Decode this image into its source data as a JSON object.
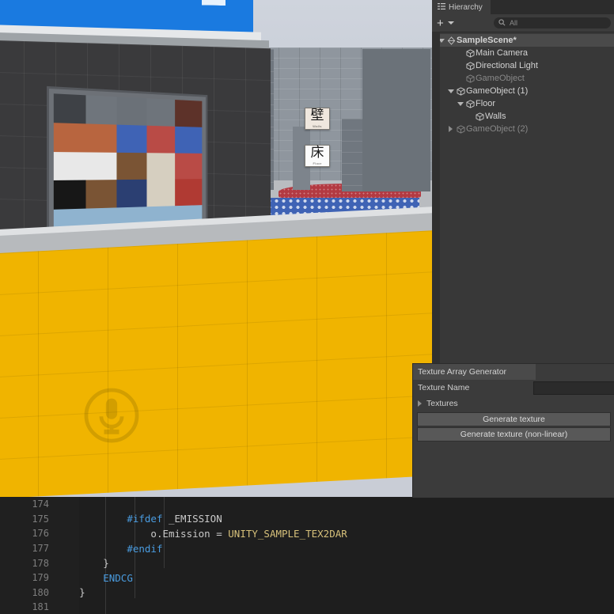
{
  "app": {
    "name": "Unity Editor",
    "colors": {
      "panel_bg": "#383838",
      "toolbar_bg": "#3c3c3c",
      "selection": "#4a4a4a",
      "code_bg": "#1e1e1e",
      "accent_yellow": "#f0b400",
      "keyword_blue": "#4a9ce0",
      "identifier_tan": "#d6c07a"
    }
  },
  "hierarchy": {
    "tab_label": "Hierarchy",
    "tab_icon": "hierarchy-icon",
    "add_button_label": "+",
    "search": {
      "placeholder": "All",
      "value": "",
      "icon": "search-icon"
    },
    "items": [
      {
        "label": "SampleScene*",
        "depth": 0,
        "icon": "unity-scene-icon",
        "twisty": "down",
        "dim": false,
        "selected": true
      },
      {
        "label": "Main Camera",
        "depth": 2,
        "icon": "gameobject-cube-icon",
        "twisty": "none",
        "dim": false,
        "selected": false
      },
      {
        "label": "Directional Light",
        "depth": 2,
        "icon": "gameobject-cube-icon",
        "twisty": "none",
        "dim": false,
        "selected": false
      },
      {
        "label": "GameObject",
        "depth": 2,
        "icon": "gameobject-cube-icon",
        "twisty": "none",
        "dim": true,
        "selected": false
      },
      {
        "label": "GameObject (1)",
        "depth": 1,
        "icon": "gameobject-cube-icon",
        "twisty": "down",
        "dim": false,
        "selected": false
      },
      {
        "label": "Floor",
        "depth": 2,
        "icon": "gameobject-cube-icon",
        "twisty": "down",
        "dim": false,
        "selected": false
      },
      {
        "label": "Walls",
        "depth": 3,
        "icon": "gameobject-cube-icon",
        "twisty": "none",
        "dim": false,
        "selected": false
      },
      {
        "label": "GameObject (2)",
        "depth": 1,
        "icon": "gameobject-cube-icon",
        "twisty": "right",
        "dim": true,
        "selected": false
      }
    ]
  },
  "texture_array_generator": {
    "title": "Texture Array Generator",
    "texture_name_label": "Texture Name",
    "texture_name_value": "",
    "textures_foldout_label": "Textures",
    "textures_foldout_expanded": false,
    "generate_button_label": "Generate texture",
    "generate_nonlinear_button_label": "Generate texture (non-linear)"
  },
  "code_editor": {
    "language": "ShaderLab / CG",
    "first_line_number": 174,
    "lines": [
      {
        "n": "174",
        "tokens": []
      },
      {
        "n": "175",
        "tokens": [
          {
            "t": "            ",
            "c": "ind"
          },
          {
            "t": "#ifdef",
            "c": "kw"
          },
          {
            "t": " _EMISSION",
            "c": "id"
          }
        ]
      },
      {
        "n": "176",
        "tokens": [
          {
            "t": "                ",
            "c": "ind"
          },
          {
            "t": "o.Emission = ",
            "c": "id"
          },
          {
            "t": "UNITY_SAMPLE_TEX2DAR",
            "c": "fn"
          }
        ]
      },
      {
        "n": "177",
        "tokens": [
          {
            "t": "            ",
            "c": "ind"
          },
          {
            "t": "#endif",
            "c": "kw"
          }
        ]
      },
      {
        "n": "178",
        "tokens": [
          {
            "t": "        ",
            "c": "ind"
          },
          {
            "t": "}",
            "c": "op"
          }
        ]
      },
      {
        "n": "179",
        "tokens": [
          {
            "t": "        ",
            "c": "ind"
          },
          {
            "t": "ENDCG",
            "c": "kw"
          }
        ]
      },
      {
        "n": "180",
        "tokens": [
          {
            "t": "    ",
            "c": "ind"
          },
          {
            "t": "}",
            "c": "op"
          }
        ]
      },
      {
        "n": "181",
        "tokens": []
      }
    ]
  },
  "game_view": {
    "signs": [
      {
        "kanji": "壁",
        "roman": "Walls"
      },
      {
        "kanji": "床",
        "roman": "Floor"
      }
    ],
    "watermark_icon": "microphone-icon",
    "texture_atlas_swatches": [
      "#3e4146",
      "#6f757c",
      "#6b7178",
      "#6e747b",
      "#5d3229",
      "#b8653f",
      "#b8653f",
      "#3f63b5",
      "#b94b46",
      "#3f63b5",
      "#e8e8e8",
      "#e8e8e8",
      "#7a5434",
      "#d6cfc0",
      "#b94b46",
      "#171717",
      "#7a5434",
      "#2b3f72",
      "#d6cfc0",
      "#b03a33",
      "#8fb3cf",
      "#8fb3cf",
      "#8fb3cf",
      "#8fb3cf",
      "#8fb3cf"
    ]
  }
}
